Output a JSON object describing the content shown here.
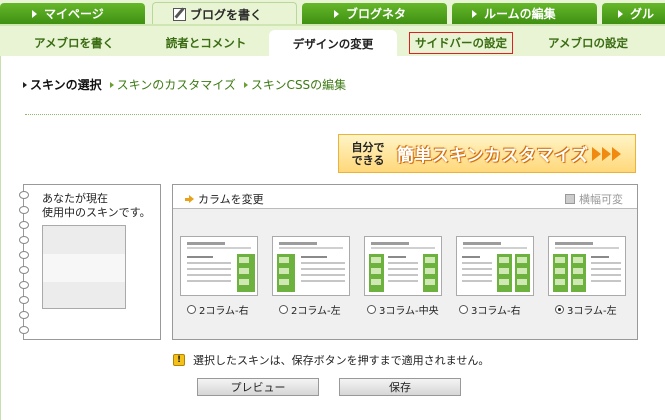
{
  "top_tabs": [
    {
      "label": "マイページ"
    },
    {
      "label": "ブログを書く"
    },
    {
      "label": "ブログネタ"
    },
    {
      "label": "ルームの編集"
    },
    {
      "label": "グル"
    }
  ],
  "sub_tabs": [
    {
      "label": "アメブロを書く"
    },
    {
      "label": "読者とコメント"
    },
    {
      "label": "デザインの変更"
    },
    {
      "label": "サイドバーの設定"
    },
    {
      "label": "アメブロの設定"
    }
  ],
  "breadcrumbs": [
    {
      "label": "スキンの選択"
    },
    {
      "label": "スキンのカスタマイズ"
    },
    {
      "label": "スキンCSSの編集"
    }
  ],
  "banner": {
    "small_line1": "自分で",
    "small_line2": "できる",
    "big": "簡単スキンカスタマイズ"
  },
  "current_skin": {
    "line1": "あなたが現在",
    "line2": "使用中のスキンです。"
  },
  "columns": {
    "change_label": "カラムを変更",
    "width_label": "横幅可変",
    "options": [
      {
        "label": "2コラム-右",
        "selected": false
      },
      {
        "label": "2コラム-左",
        "selected": false
      },
      {
        "label": "3コラム-中央",
        "selected": false
      },
      {
        "label": "3コラム-右",
        "selected": false
      },
      {
        "label": "3コラム-左",
        "selected": true
      }
    ]
  },
  "warning": "選択したスキンは、保存ボタンを押すまで適用されません。",
  "buttons": {
    "preview": "プレビュー",
    "save": "保存"
  },
  "colors": {
    "tab_green": "#3f8f12",
    "bg": "#e9f4d6",
    "highlight": "#e02020",
    "banner": "#ffd87a"
  }
}
